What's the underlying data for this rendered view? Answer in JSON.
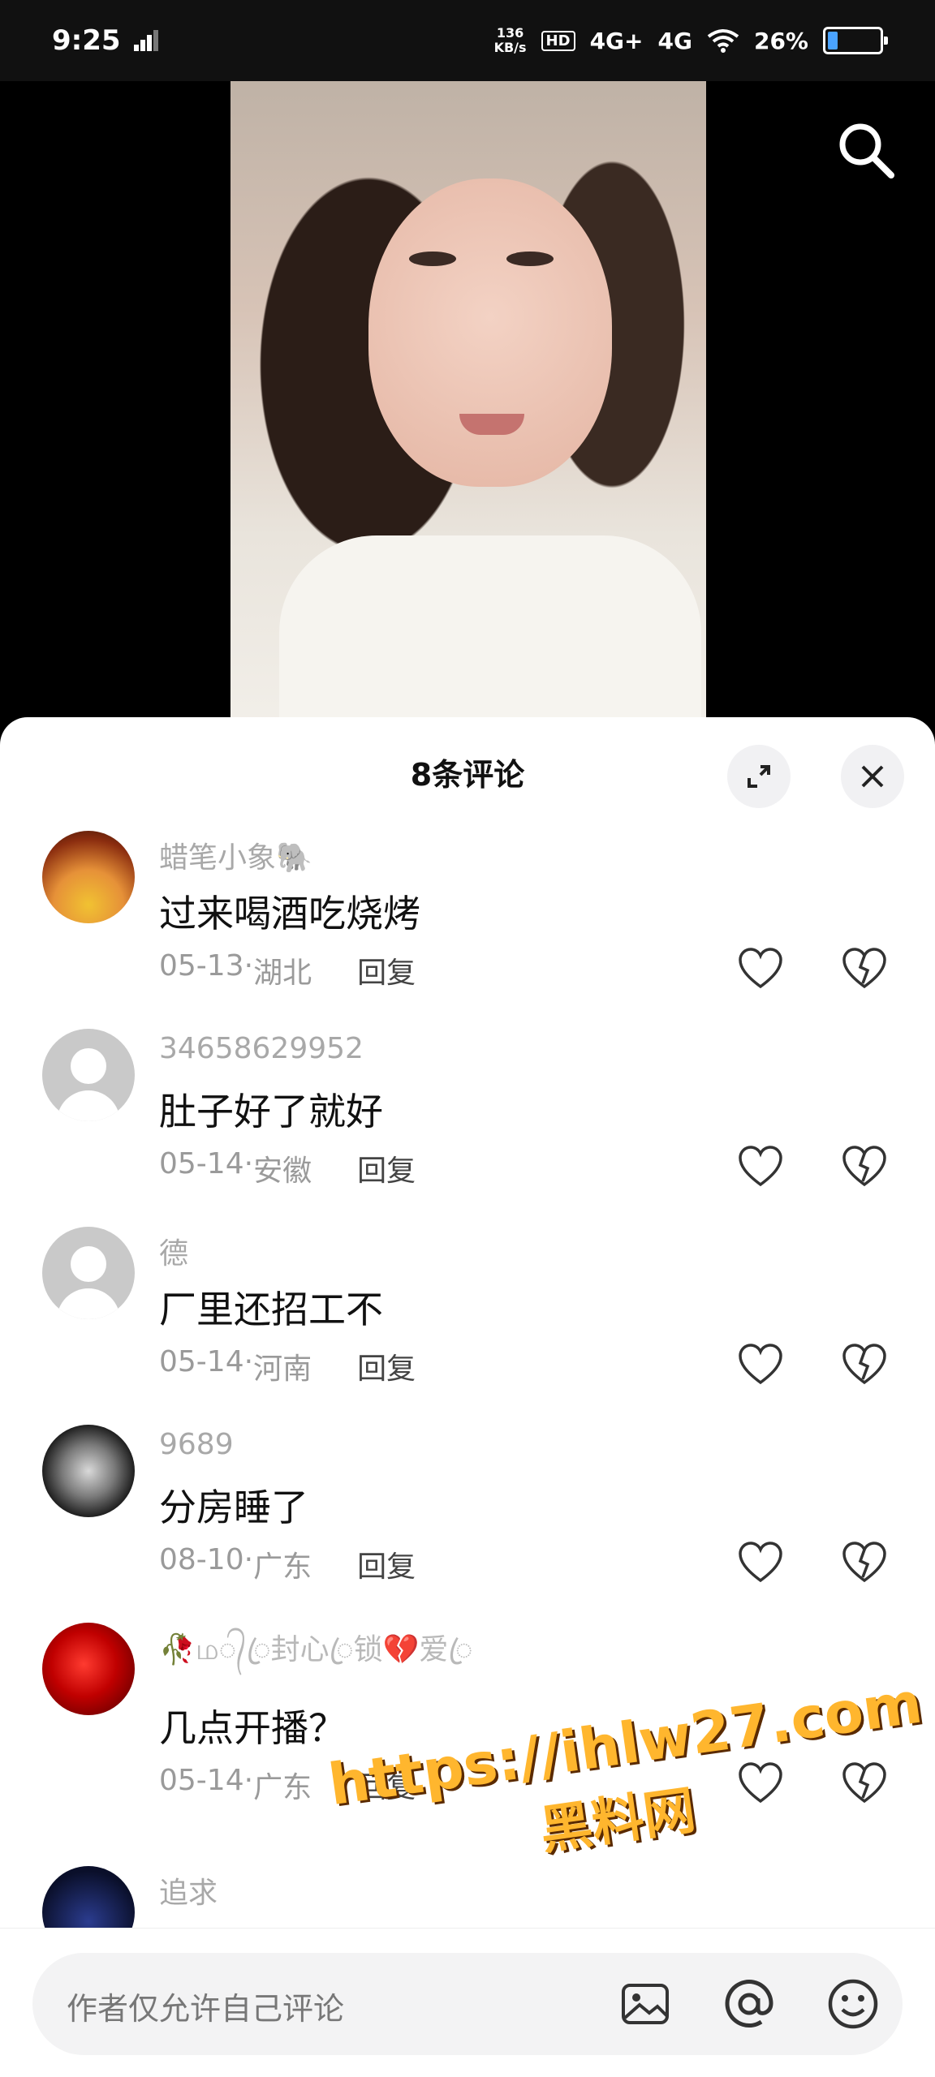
{
  "status_bar": {
    "time": "9:25",
    "net_speed_value": "136",
    "net_speed_unit": "KB/s",
    "hd_label": "HD",
    "signal_1": "4G+",
    "signal_2": "4G",
    "battery": "26%",
    "battery_level": 0.26,
    "battery_fill_color": "#4aa3ff"
  },
  "header": {
    "title": "8条评论"
  },
  "comments": [
    {
      "username": "蜡笔小象🐘",
      "text": "过来喝酒吃烧烤",
      "date": "05-13",
      "location": "湖北",
      "reply": "回复",
      "avatar": "autumn-trees"
    },
    {
      "username": "34658629952",
      "text": "肚子好了就好",
      "date": "05-14",
      "location": "安徽",
      "reply": "回复",
      "avatar": "default-user"
    },
    {
      "username": "德",
      "text": "厂里还招工不",
      "date": "05-14",
      "location": "河南",
      "reply": "回复",
      "avatar": "default-user"
    },
    {
      "username": "9689",
      "text": "分房睡了",
      "date": "08-10",
      "location": "广东",
      "reply": "回复",
      "avatar": "joker-face"
    },
    {
      "username": "🥀ம᭄ꦿ封心ꦿ锁💔爱ꦿ",
      "text": "几点开播？",
      "date": "05-14",
      "location": "广东",
      "reply": "回复",
      "avatar": "red-flowers"
    },
    {
      "username": "追求",
      "text": "",
      "date": "",
      "location": "",
      "reply": "",
      "avatar": "night-scene"
    }
  ],
  "watermark": {
    "url": "https://ihlw27.com",
    "name": "黑料网"
  },
  "input": {
    "placeholder": "作者仅允许自己评论"
  },
  "icons": {
    "search": "search-icon",
    "expand": "expand-icon",
    "close": "close-icon",
    "like": "heart-icon",
    "dislike": "broken-heart-icon",
    "image": "image-icon",
    "mention": "at-icon",
    "emoji": "emoji-icon"
  }
}
